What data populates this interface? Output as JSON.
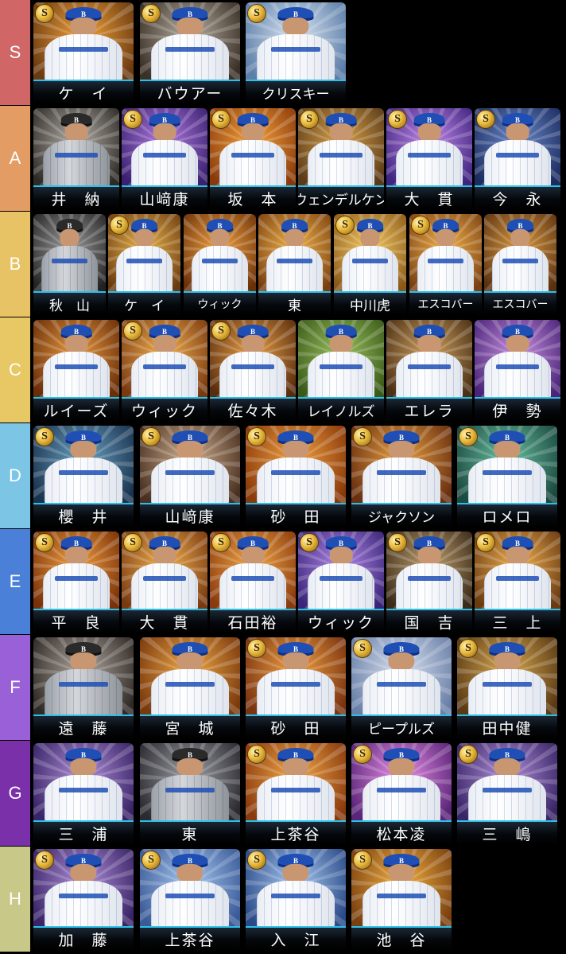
{
  "tiers": [
    {
      "label": "S",
      "color": "#d06766",
      "cards": [
        {
          "name": "ケ　イ",
          "badge": "S",
          "bg": [
            "#f2a23a",
            "#6b3a10"
          ]
        },
        {
          "name": "バウアー",
          "badge": "S",
          "bg": [
            "#b9b0a4",
            "#3a3026"
          ]
        },
        {
          "name": "クリスキー",
          "badge": "S",
          "bg": [
            "#d8e4f2",
            "#5c7ea8"
          ]
        }
      ]
    },
    {
      "label": "A",
      "color": "#e49c65",
      "cards": [
        {
          "name": "井　納",
          "badge": "",
          "bg": [
            "#b6b0a8",
            "#2e2a26"
          ],
          "dark": true
        },
        {
          "name": "山﨑康",
          "badge": "S",
          "bg": [
            "#b07ae0",
            "#3a2070"
          ]
        },
        {
          "name": "坂　本",
          "badge": "S",
          "bg": [
            "#f5a23a",
            "#8a3a0a"
          ]
        },
        {
          "name": "ウェンデルケン",
          "badge": "S",
          "bg": [
            "#d9a24a",
            "#5a3a18"
          ]
        },
        {
          "name": "大　貫",
          "badge": "S",
          "bg": [
            "#c088e8",
            "#402480"
          ]
        },
        {
          "name": "今　永",
          "badge": "S",
          "bg": [
            "#6a88c8",
            "#1c2c60"
          ]
        }
      ]
    },
    {
      "label": "B",
      "color": "#e8c365",
      "cards": [
        {
          "name": "秋　山",
          "badge": "",
          "bg": [
            "#9a9a9a",
            "#222"
          ],
          "dark": true
        },
        {
          "name": "ケ　イ",
          "badge": "S",
          "bg": [
            "#e8b24a",
            "#6a3a10"
          ]
        },
        {
          "name": "ウィック",
          "badge": "",
          "bg": [
            "#f0a040",
            "#6a3008"
          ]
        },
        {
          "name": "東",
          "badge": "",
          "bg": [
            "#f0b24a",
            "#7a4010"
          ]
        },
        {
          "name": "中川虎",
          "badge": "S",
          "bg": [
            "#f2c860",
            "#8a5818"
          ]
        },
        {
          "name": "エスコバー",
          "badge": "S",
          "bg": [
            "#f0b04a",
            "#7a4012"
          ]
        },
        {
          "name": "エスコバー",
          "badge": "",
          "bg": [
            "#d89a40",
            "#5a3010"
          ]
        }
      ]
    },
    {
      "label": "C",
      "color": "#e8c865",
      "cards": [
        {
          "name": "ルイーズ",
          "badge": "",
          "bg": [
            "#e89a40",
            "#6a2e08"
          ]
        },
        {
          "name": "ウィック",
          "badge": "S",
          "bg": [
            "#f2b050",
            "#7a3a10"
          ]
        },
        {
          "name": "佐々木",
          "badge": "S",
          "bg": [
            "#e8a048",
            "#5a2c0c"
          ]
        },
        {
          "name": "レイノルズ",
          "badge": "",
          "bg": [
            "#9ac060",
            "#3a5a18"
          ]
        },
        {
          "name": "エレラ",
          "badge": "",
          "bg": [
            "#d0a060",
            "#4a3014"
          ]
        },
        {
          "name": "伊　勢",
          "badge": "",
          "bg": [
            "#c890e0",
            "#4a2478"
          ]
        }
      ]
    },
    {
      "label": "D",
      "color": "#7cc5e4",
      "cards": [
        {
          "name": "櫻　井",
          "badge": "S",
          "bg": [
            "#6aa0c0",
            "#1a3450"
          ]
        },
        {
          "name": "山﨑康",
          "badge": "S",
          "bg": [
            "#d0b090",
            "#4a3020"
          ]
        },
        {
          "name": "砂　田",
          "badge": "S",
          "bg": [
            "#f2a040",
            "#8a3a0a"
          ]
        },
        {
          "name": "ジャクソン",
          "badge": "S",
          "bg": [
            "#e8a040",
            "#6a3010"
          ]
        },
        {
          "name": "ロメロ",
          "badge": "S",
          "bg": [
            "#6ac0a0",
            "#1a4a40"
          ]
        }
      ]
    },
    {
      "label": "E",
      "color": "#4a80d8",
      "cards": [
        {
          "name": "平　良",
          "badge": "S",
          "bg": [
            "#f0a040",
            "#7a3008"
          ]
        },
        {
          "name": "大　貫",
          "badge": "S",
          "bg": [
            "#f0b050",
            "#7a3a10"
          ]
        },
        {
          "name": "石田裕",
          "badge": "S",
          "bg": [
            "#f2a848",
            "#8a3a0c"
          ]
        },
        {
          "name": "ウィック",
          "badge": "S",
          "bg": [
            "#b088e8",
            "#3a2478"
          ]
        },
        {
          "name": "国　吉",
          "badge": "S",
          "bg": [
            "#c0a070",
            "#3a2a18"
          ]
        },
        {
          "name": "三　上",
          "badge": "S",
          "bg": [
            "#f0b050",
            "#6a3a10"
          ]
        }
      ]
    },
    {
      "label": "F",
      "color": "#9a60d8",
      "cards": [
        {
          "name": "遠　藤",
          "badge": "",
          "bg": [
            "#b0a8a0",
            "#302a26"
          ],
          "dark": true
        },
        {
          "name": "宮　城",
          "badge": "",
          "bg": [
            "#f0a848",
            "#7a3a0c"
          ]
        },
        {
          "name": "砂　田",
          "badge": "S",
          "bg": [
            "#f2a040",
            "#7a3410"
          ]
        },
        {
          "name": "ピープルズ",
          "badge": "S",
          "bg": [
            "#d8e0f0",
            "#6a80a8"
          ]
        },
        {
          "name": "田中健",
          "badge": "S",
          "bg": [
            "#d8a850",
            "#5a3a14"
          ]
        }
      ]
    },
    {
      "label": "G",
      "color": "#7a30a8",
      "cards": [
        {
          "name": "三　浦",
          "badge": "",
          "bg": [
            "#b090d8",
            "#3a2468"
          ]
        },
        {
          "name": "東",
          "badge": "",
          "bg": [
            "#a0a0a8",
            "#2a2a30"
          ],
          "dark": true
        },
        {
          "name": "上茶谷",
          "badge": "S",
          "bg": [
            "#f2a848",
            "#8a3a0c"
          ]
        },
        {
          "name": "松本凌",
          "badge": "S",
          "bg": [
            "#e890e8",
            "#5a2478"
          ]
        },
        {
          "name": "三　嶋",
          "badge": "S",
          "bg": [
            "#b090d8",
            "#3a2468"
          ]
        }
      ]
    },
    {
      "label": "H",
      "color": "#c8c888",
      "cards": [
        {
          "name": "加　藤",
          "badge": "S",
          "bg": [
            "#b090d8",
            "#3a2468"
          ]
        },
        {
          "name": "上茶谷",
          "badge": "S",
          "bg": [
            "#a8c8f0",
            "#3a5a98"
          ]
        },
        {
          "name": "入　江",
          "badge": "S",
          "bg": [
            "#a8c8f0",
            "#2a4a88"
          ]
        },
        {
          "name": "池　谷",
          "badge": "S",
          "bg": [
            "#f2b040",
            "#7a4010"
          ]
        }
      ]
    }
  ]
}
